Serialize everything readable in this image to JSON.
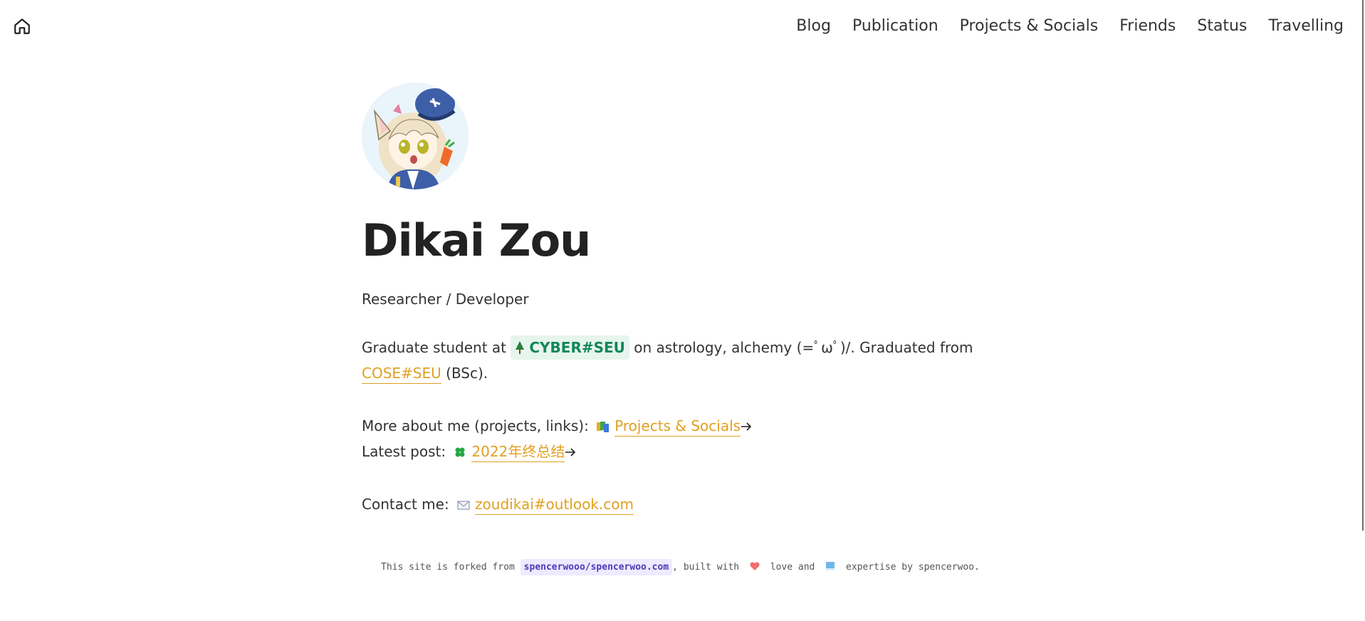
{
  "header": {
    "home_icon": "home-icon",
    "nav": [
      {
        "label": "Blog"
      },
      {
        "label": "Publication"
      },
      {
        "label": "Projects & Socials"
      },
      {
        "label": "Friends"
      },
      {
        "label": "Status"
      },
      {
        "label": "Travelling"
      }
    ]
  },
  "profile": {
    "name": "Dikai Zou",
    "role": "Researcher / Developer",
    "grad": {
      "prefix": "Graduate student at ",
      "badge": "CYBER#SEU",
      "mid": " on astrology, alchemy (=ﾟωﾟ)/. Graduated from ",
      "school_link": "COSE#SEU",
      "suffix": " (BSc)."
    },
    "more": {
      "prefix": "More about me (projects, links): ",
      "link": "Projects & Socials"
    },
    "latest": {
      "prefix": "Latest post: ",
      "link": "2022年终总结"
    },
    "contact": {
      "prefix": "Contact me: ",
      "link": "zoudikai#outlook.com"
    }
  },
  "footer": {
    "prefix": "This site is forked from ",
    "repo": "spencerwooo/spencerwoo.com",
    "mid1": ", built with ",
    "mid2": " love and ",
    "suffix": " expertise by spencerwoo."
  },
  "colors": {
    "accent_link": "#e0a020",
    "badge_bg": "#e6f5ee",
    "badge_text": "#15865a",
    "code_bg": "#eeeaff",
    "code_text": "#4b3bb8"
  }
}
